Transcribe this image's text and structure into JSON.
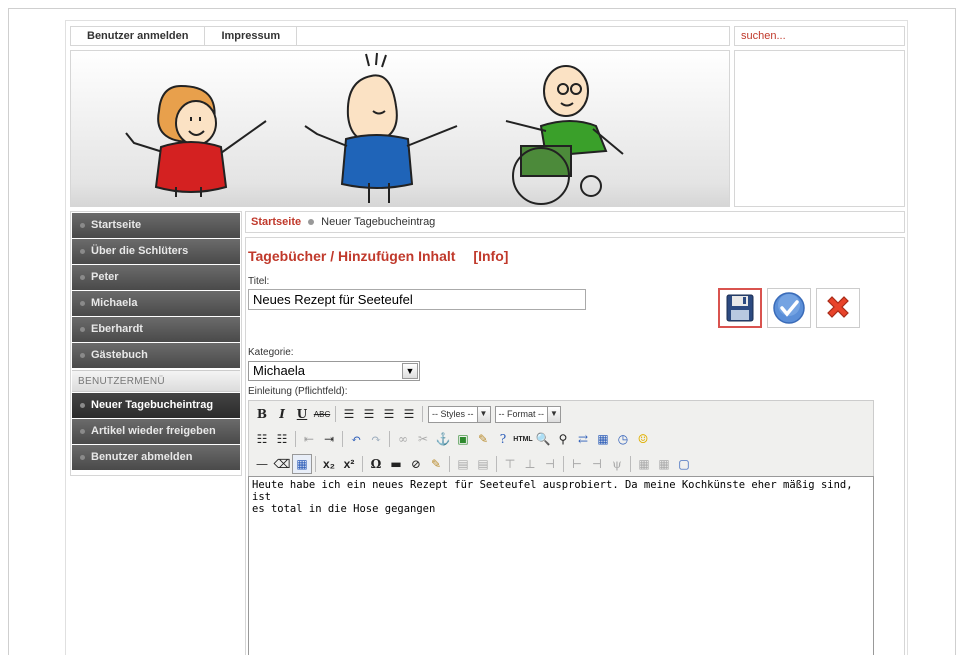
{
  "topnav": {
    "login": "Benutzer anmelden",
    "impressum": "Impressum"
  },
  "search": {
    "placeholder": "suchen..."
  },
  "sidebar": {
    "items": [
      {
        "label": "Startseite"
      },
      {
        "label": "Über die Schlüters"
      },
      {
        "label": "Peter"
      },
      {
        "label": "Michaela"
      },
      {
        "label": "Eberhardt"
      },
      {
        "label": "Gästebuch"
      }
    ],
    "user_menu_header": "BENUTZERMENÜ",
    "user_items": [
      {
        "label": "Neuer Tagebucheintrag"
      },
      {
        "label": "Artikel wieder freigeben"
      },
      {
        "label": "Benutzer abmelden"
      }
    ]
  },
  "breadcrumb": {
    "home": "Startseite",
    "current": "Neuer Tagebucheintrag"
  },
  "form": {
    "heading": "Tagebücher / Hinzufügen  Inhalt",
    "info": "[Info]",
    "title_label": "Titel:",
    "title_value": "Neues Rezept für Seeteufel",
    "category_label": "Kategorie:",
    "category_value": "Michaela",
    "intro_label": "Einleitung (Pflichtfeld):",
    "editor_text": "Heute habe ich ein neues Rezept für Seeteufel ausprobiert. Da meine Kochkünste eher mäßig sind, ist\nes total in die Hose gegangen"
  },
  "toolbar": {
    "styles": "-- Styles --",
    "format": "-- Format --",
    "html": "HTML"
  },
  "colors": {
    "accent": "#c0392b",
    "menu_bg": "#4a4a4a"
  }
}
